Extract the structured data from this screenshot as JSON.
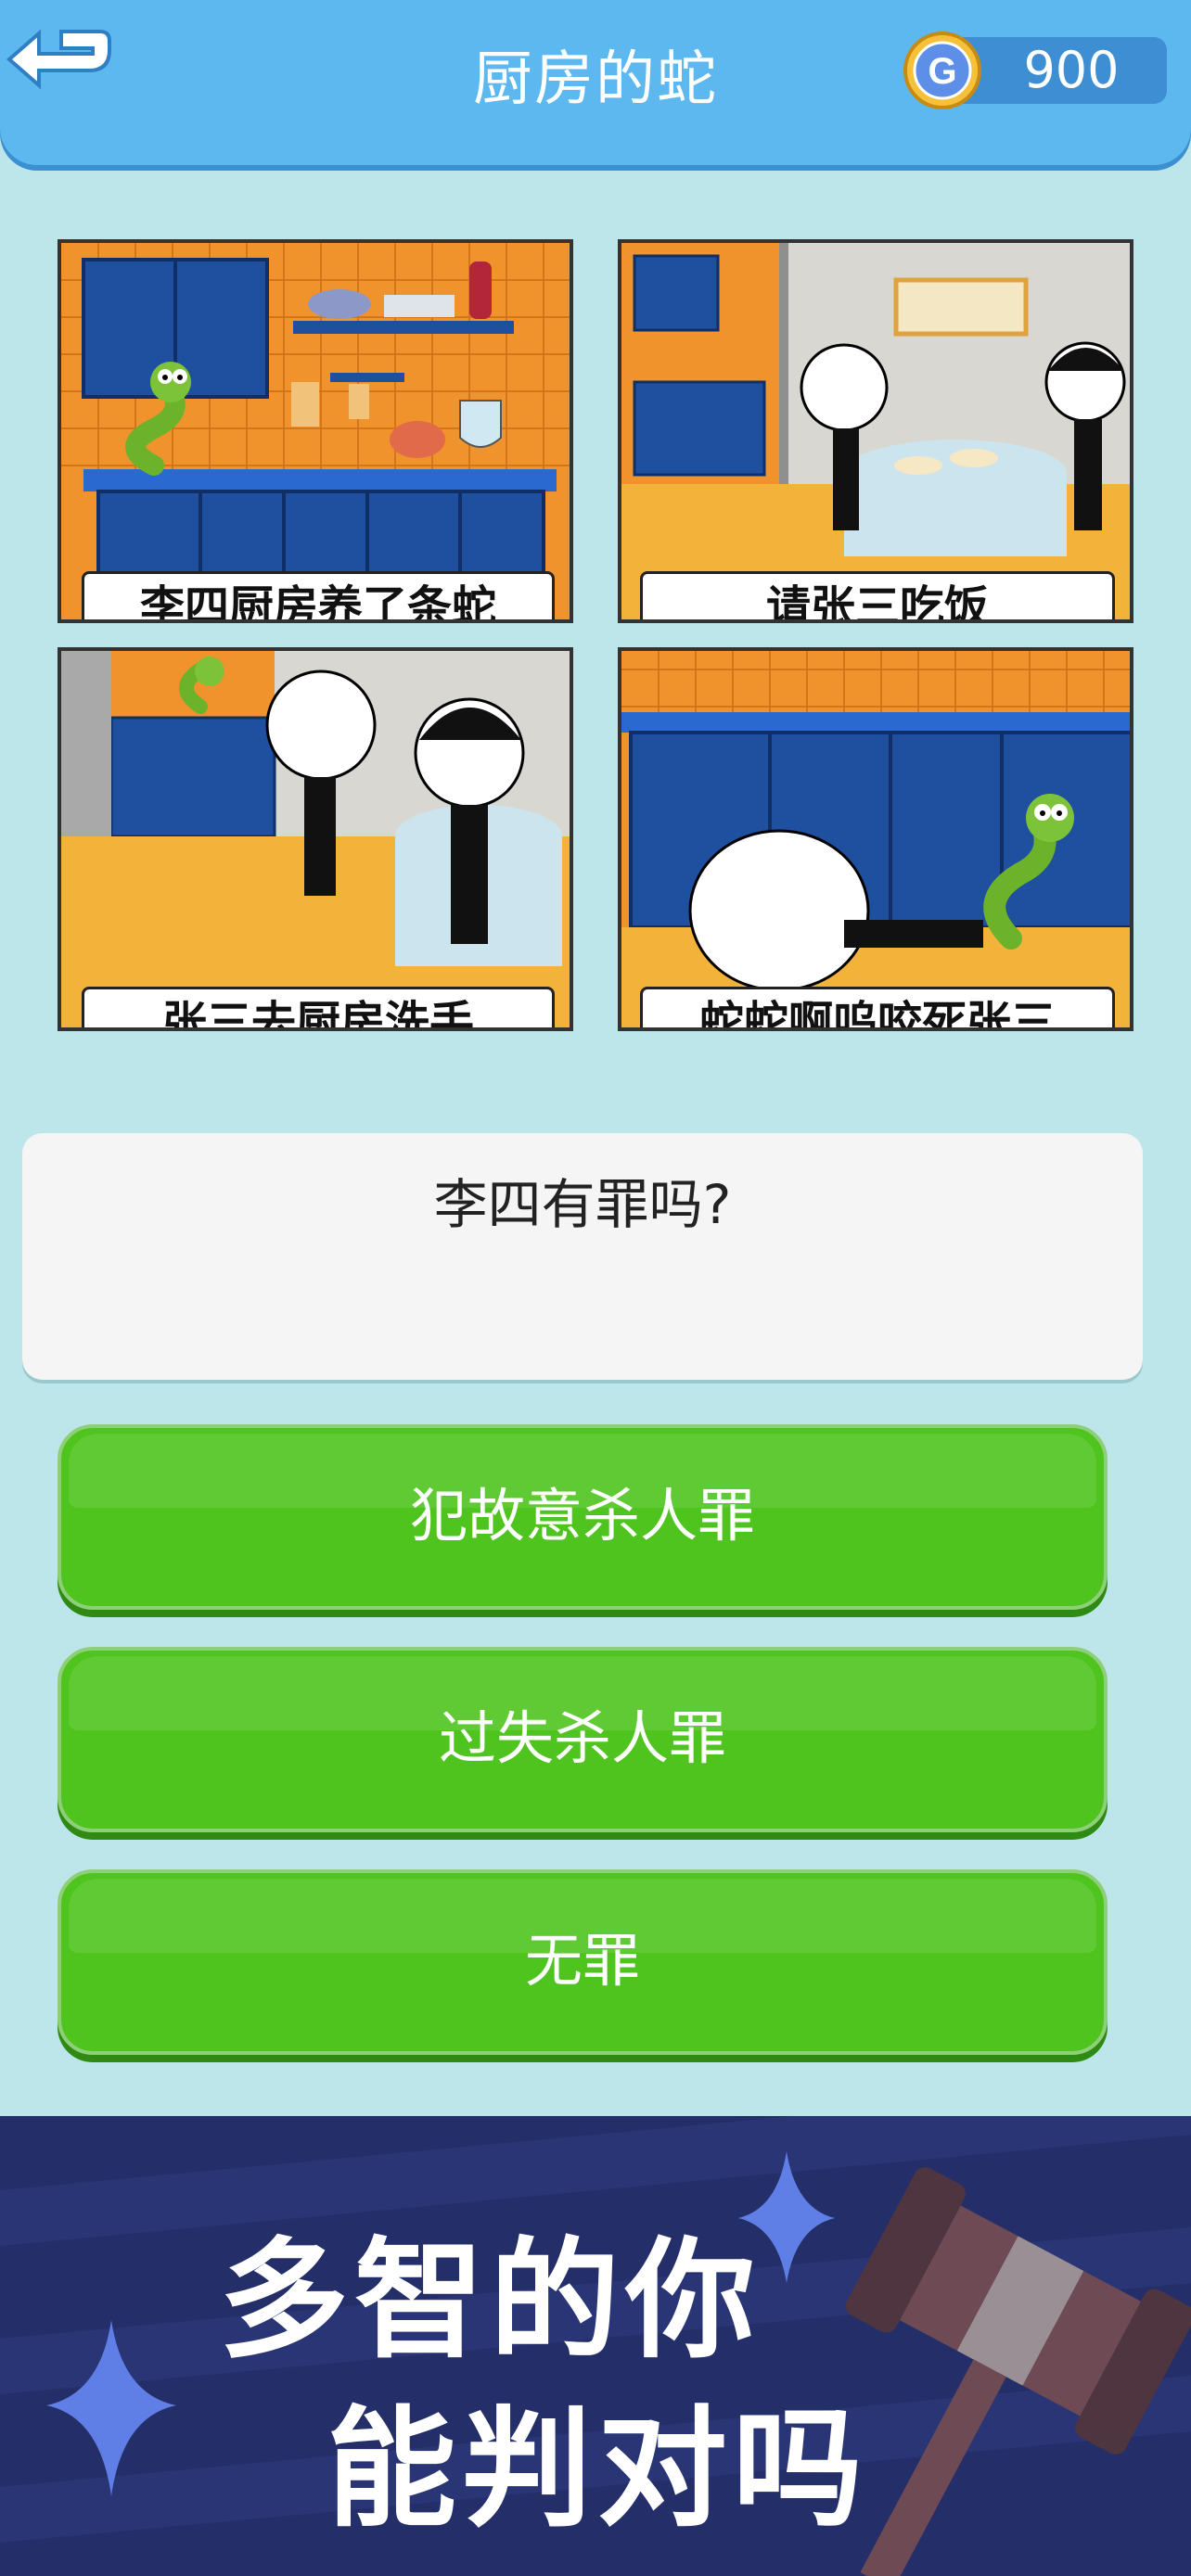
{
  "header": {
    "title": "厨房的蛇",
    "coins": "900",
    "back_icon": "back-arrow-icon",
    "coin_icon": "coin-icon"
  },
  "panels": [
    {
      "caption": "李四厨房养了条蛇"
    },
    {
      "caption": "请张三吃饭"
    },
    {
      "caption": "张三去厨房洗手"
    },
    {
      "caption": "蛇蛇啊呜咬死张三"
    }
  ],
  "question": {
    "text": "李四有罪吗?"
  },
  "answers": [
    {
      "label": "犯故意杀人罪"
    },
    {
      "label": "过失杀人罪"
    },
    {
      "label": "无罪"
    }
  ],
  "promo": {
    "line1": "多智的你",
    "line2": "能判对吗"
  },
  "colors": {
    "background": "#bde6ea",
    "header": "#5cb8ee",
    "answer_button": "#4fc41f",
    "promo_banner": "#242e68"
  }
}
